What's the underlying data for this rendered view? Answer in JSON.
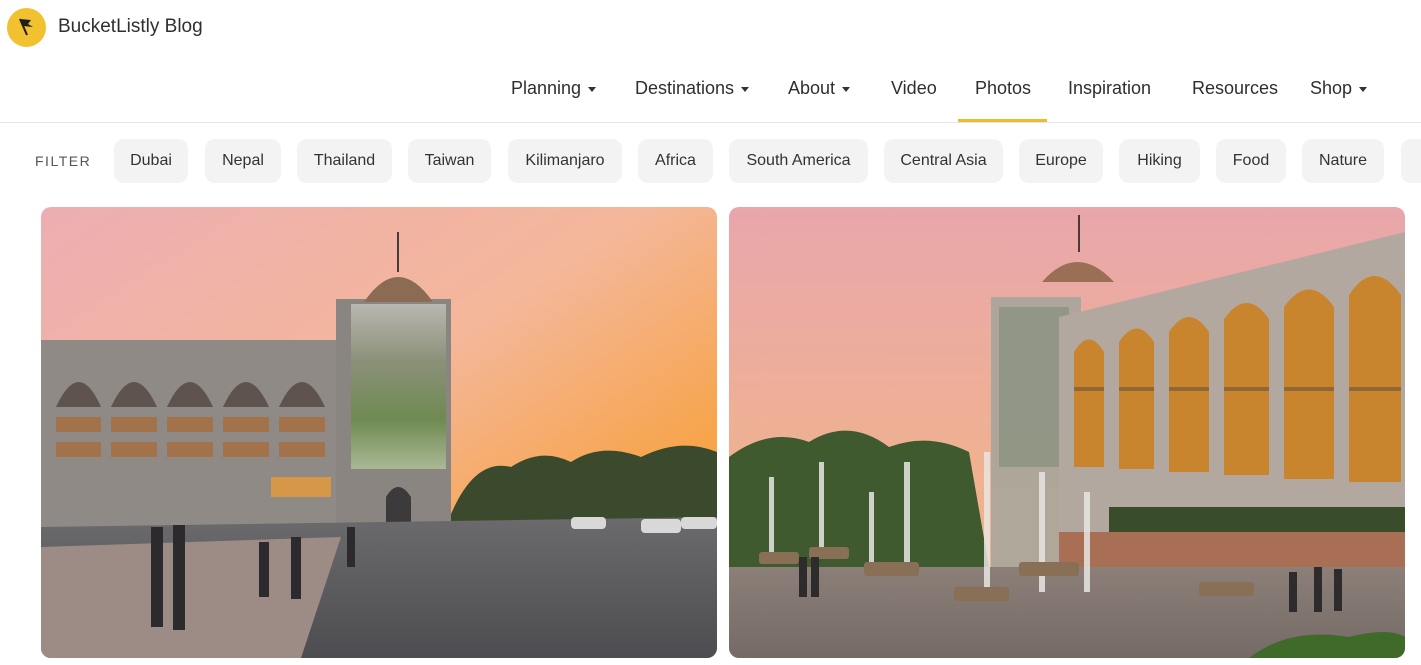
{
  "header": {
    "brand": "BucketListly Blog",
    "logo_icon": "flag-icon",
    "accent_color": "#e9bd2c"
  },
  "nav": {
    "items": [
      {
        "label": "Planning",
        "dropdown": true
      },
      {
        "label": "Destinations",
        "dropdown": true
      },
      {
        "label": "About",
        "dropdown": true
      },
      {
        "label": "Video",
        "dropdown": false
      },
      {
        "label": "Photos",
        "dropdown": false,
        "active": true
      },
      {
        "label": "Inspiration",
        "dropdown": false
      },
      {
        "label": "Resources",
        "dropdown": false
      },
      {
        "label": "Shop",
        "dropdown": true
      }
    ]
  },
  "filter": {
    "label": "FILTER",
    "chips": [
      "Dubai",
      "Nepal",
      "Thailand",
      "Taiwan",
      "Kilimanjaro",
      "Africa",
      "South America",
      "Central Asia",
      "Europe",
      "Hiking",
      "Food",
      "Nature"
    ]
  },
  "gallery": {
    "photos": [
      {
        "subject": "government building with dome at sunset"
      },
      {
        "subject": "arched building with fountains at sunset"
      }
    ]
  }
}
